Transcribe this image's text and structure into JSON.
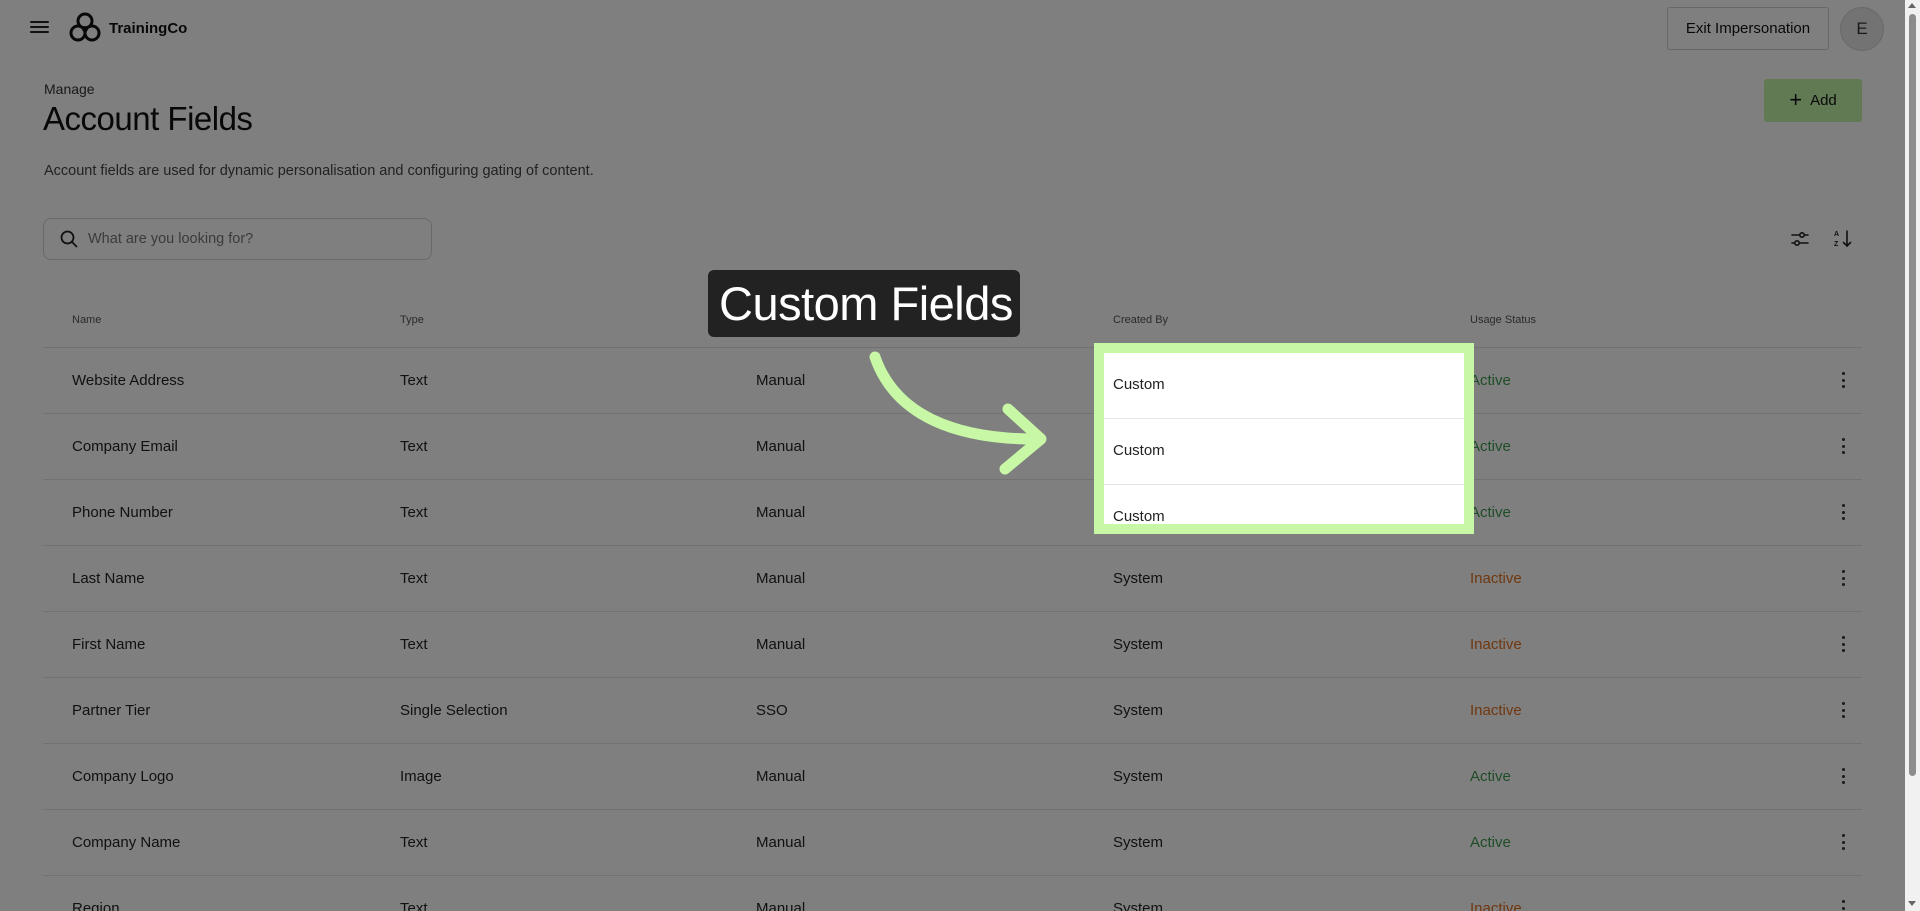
{
  "header": {
    "app_name": "TrainingCo",
    "exit_label": "Exit Impersonation",
    "avatar_initial": "E"
  },
  "page": {
    "breadcrumb": "Manage",
    "title": "Account Fields",
    "description": "Account fields are used for dynamic personalisation and configuring gating of content.",
    "add_label": "Add",
    "search_placeholder": "What are you looking for?"
  },
  "table": {
    "columns": [
      "Name",
      "Type",
      "",
      "Created By",
      "Usage Status"
    ],
    "rows": [
      {
        "name": "Website Address",
        "type": "Text",
        "source": "Manual",
        "created_by": "Custom",
        "status": "Active"
      },
      {
        "name": "Company Email",
        "type": "Text",
        "source": "Manual",
        "created_by": "Custom",
        "status": "Active"
      },
      {
        "name": "Phone Number",
        "type": "Text",
        "source": "Manual",
        "created_by": "Custom",
        "status": "Active"
      },
      {
        "name": "Last Name",
        "type": "Text",
        "source": "Manual",
        "created_by": "System",
        "status": "Inactive"
      },
      {
        "name": "First Name",
        "type": "Text",
        "source": "Manual",
        "created_by": "System",
        "status": "Inactive"
      },
      {
        "name": "Partner Tier",
        "type": "Single Selection",
        "source": "SSO",
        "created_by": "System",
        "status": "Inactive"
      },
      {
        "name": "Company Logo",
        "type": "Image",
        "source": "Manual",
        "created_by": "System",
        "status": "Active"
      },
      {
        "name": "Company Name",
        "type": "Text",
        "source": "Manual",
        "created_by": "System",
        "status": "Active"
      },
      {
        "name": "Region",
        "type": "Text",
        "source": "Manual",
        "created_by": "System",
        "status": "Inactive"
      }
    ]
  },
  "annotation": {
    "callout": "Custom Fields",
    "highlight_color": "#c8f8a6"
  },
  "colors": {
    "accent": "#c4f5a8",
    "active": "#3d9a4d",
    "inactive": "#e0701f"
  }
}
